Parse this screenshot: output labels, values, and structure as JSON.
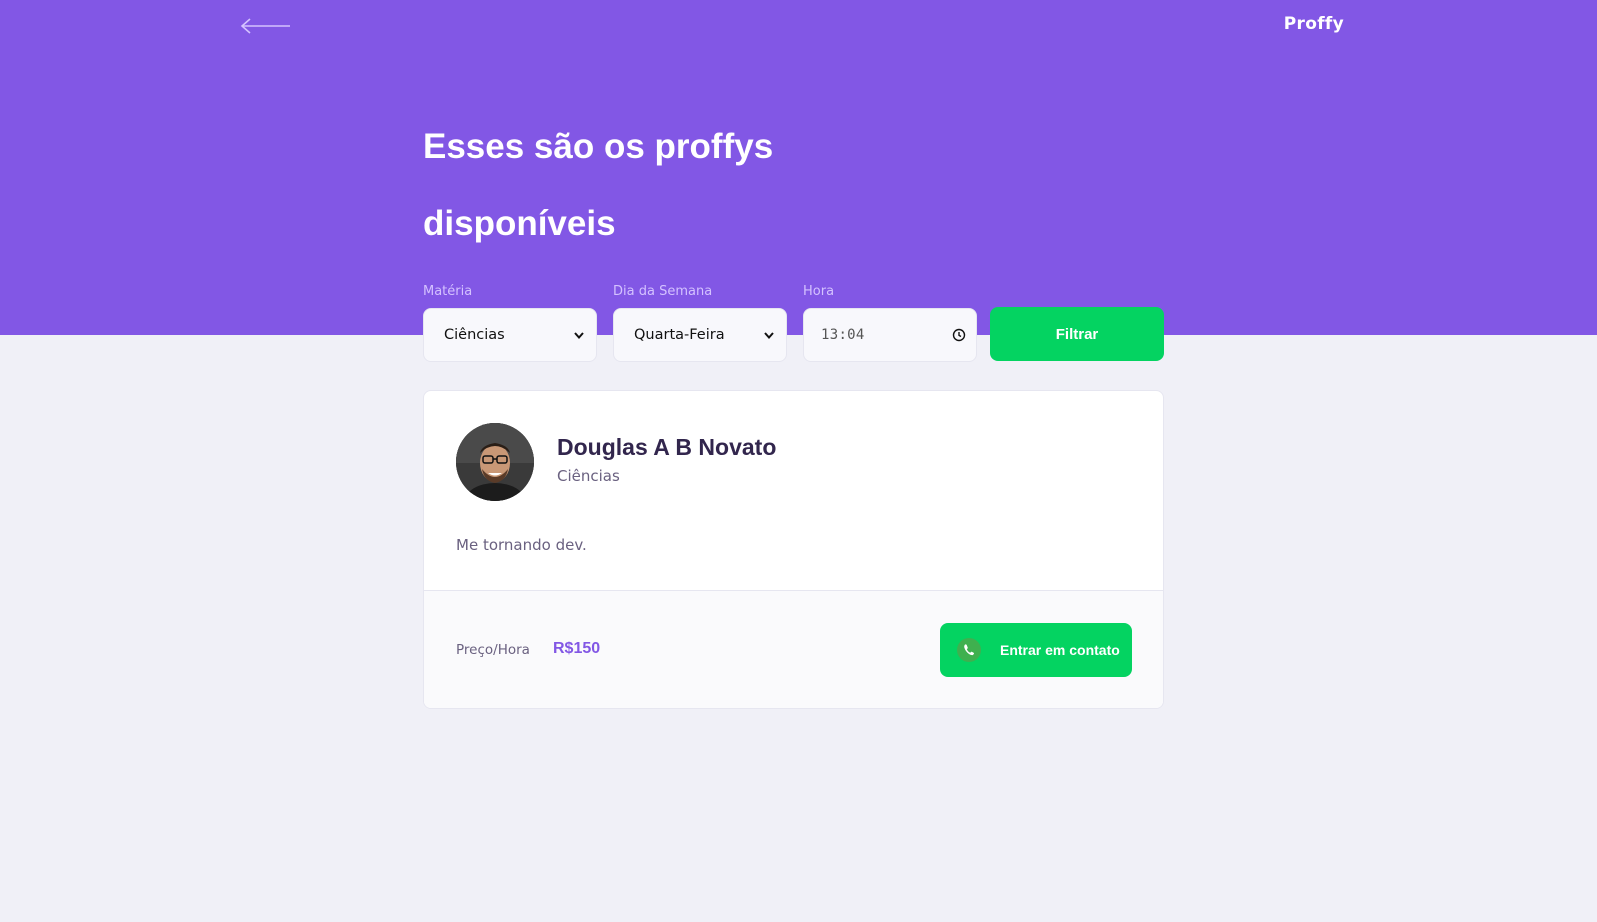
{
  "app": {
    "logo": "Proffy"
  },
  "header": {
    "title": "Esses são os proffys disponíveis"
  },
  "filters": {
    "subject": {
      "label": "Matéria",
      "value": "Ciências"
    },
    "weekday": {
      "label": "Dia da Semana",
      "value": "Quarta-Feira"
    },
    "time": {
      "label": "Hora",
      "value": "13:04"
    },
    "submit_label": "Filtrar"
  },
  "teacher": {
    "name": "Douglas A B Novato",
    "subject": "Ciências",
    "bio": "Me tornando dev.",
    "price_label": "Preço/Hora",
    "price": "R$150",
    "contact_label": "Entrar em contato"
  },
  "icons": {
    "back": "arrow-left-icon",
    "select": "chevron-down-icon",
    "time": "clock-icon",
    "contact": "whatsapp-icon"
  },
  "colors": {
    "primary": "#8257E5",
    "secondary": "#04D361",
    "background": "#F0F0F7",
    "title_text": "#32264D",
    "body_text": "#6A6180"
  }
}
